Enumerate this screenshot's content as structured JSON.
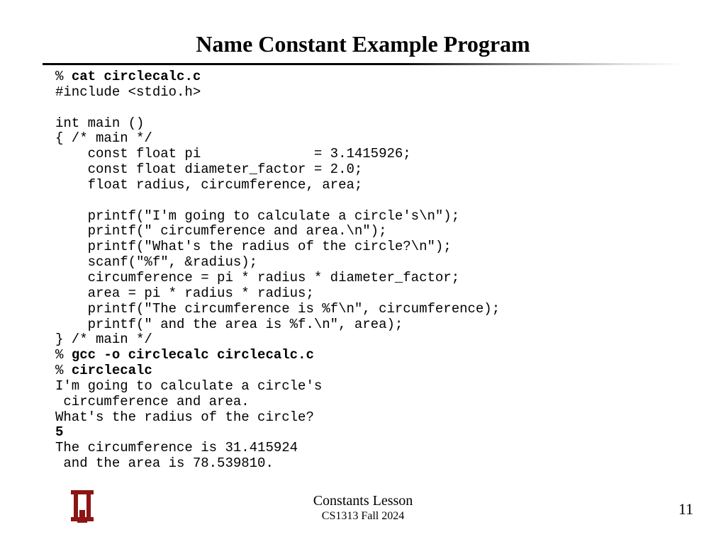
{
  "title": "Name Constant Example Program",
  "code": {
    "l01a": "% ",
    "l01b": "cat circlecalc.c",
    "l02": "#include <stdio.h>",
    "l03": "",
    "l04": "int main ()",
    "l05": "{ /* main */",
    "l06": "    const float pi              = 3.1415926;",
    "l07": "    const float diameter_factor = 2.0;",
    "l08": "    float radius, circumference, area;",
    "l09": "",
    "l10": "    printf(\"I'm going to calculate a circle's\\n\");",
    "l11": "    printf(\" circumference and area.\\n\");",
    "l12": "    printf(\"What's the radius of the circle?\\n\");",
    "l13": "    scanf(\"%f\", &radius);",
    "l14": "    circumference = pi * radius * diameter_factor;",
    "l15": "    area = pi * radius * radius;",
    "l16": "    printf(\"The circumference is %f\\n\", circumference);",
    "l17": "    printf(\" and the area is %f.\\n\", area);",
    "l18": "} /* main */",
    "l19a": "% ",
    "l19b": "gcc -o circlecalc circlecalc.c",
    "l20a": "% ",
    "l20b": "circlecalc",
    "l21": "I'm going to calculate a circle's",
    "l22": " circumference and area.",
    "l23": "What's the radius of the circle?",
    "l24": "5",
    "l25": "The circumference is 31.415924",
    "l26": " and the area is 78.539810."
  },
  "footer": {
    "lesson": "Constants Lesson",
    "course": "CS1313 Fall 2024",
    "page": "11",
    "logo_color": "#8c1515"
  }
}
